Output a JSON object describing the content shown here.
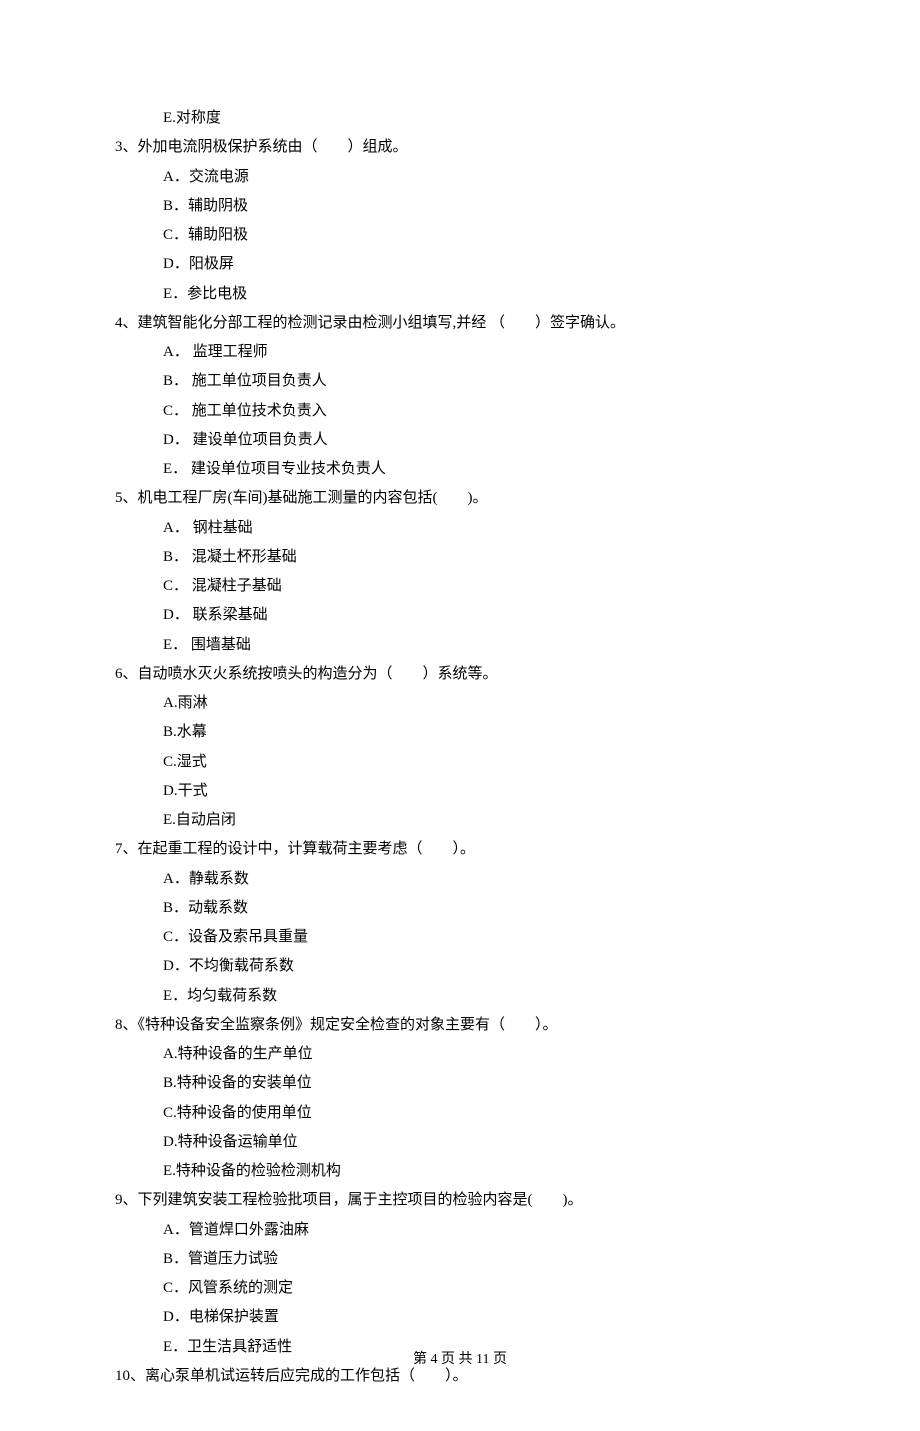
{
  "prev_question_trailing_option": "E.对称度",
  "questions": [
    {
      "num": "3、",
      "stem": "外加电流阴极保护系统由（　　）组成。",
      "options": [
        "A．交流电源",
        "B．辅助阴极",
        "C．辅助阳极",
        "D．阳极屏",
        "E．参比电极"
      ]
    },
    {
      "num": "4、",
      "stem": "建筑智能化分部工程的检测记录由检测小组填写,并经 （　　）签字确认。",
      "options": [
        "A． 监理工程师",
        "B． 施工单位项目负责人",
        "C． 施工单位技术负责入",
        "D． 建设单位项目负责人",
        "E． 建设单位项目专业技术负责人"
      ]
    },
    {
      "num": "5、",
      "stem": "机电工程厂房(车间)基础施工测量的内容包括(　　)。",
      "options": [
        "A． 钢柱基础",
        "B． 混凝土杯形基础",
        "C． 混凝柱子基础",
        "D． 联系梁基础",
        "E． 围墙基础"
      ]
    },
    {
      "num": "6、",
      "stem": "自动喷水灭火系统按喷头的构造分为（　　）系统等。",
      "options": [
        "A.雨淋",
        "B.水幕",
        "C.湿式",
        "D.干式",
        "E.自动启闭"
      ]
    },
    {
      "num": "7、",
      "stem": "在起重工程的设计中，计算载荷主要考虑（　　）。",
      "options": [
        "A．静载系数",
        "B．动载系数",
        "C．设备及索吊具重量",
        "D．不均衡载荷系数",
        "E．均匀载荷系数"
      ]
    },
    {
      "num": "8、",
      "stem": "《特种设备安全监察条例》规定安全检查的对象主要有（　　）。",
      "options": [
        "A.特种设备的生产单位",
        "B.特种设备的安装单位",
        "C.特种设备的使用单位",
        "D.特种设备运输单位",
        "E.特种设备的检验检测机构"
      ]
    },
    {
      "num": "9、",
      "stem": "下列建筑安装工程检验批项目，属于主控项目的检验内容是(　　)。",
      "options": [
        "A．管道焊口外露油麻",
        "B．管道压力试验",
        "C．风管系统的测定",
        "D．电梯保护装置",
        "E．卫生洁具舒适性"
      ]
    },
    {
      "num": "10、",
      "stem": "离心泵单机试运转后应完成的工作包括（　　）。",
      "options": []
    }
  ],
  "footer": "第 4 页 共 11 页"
}
